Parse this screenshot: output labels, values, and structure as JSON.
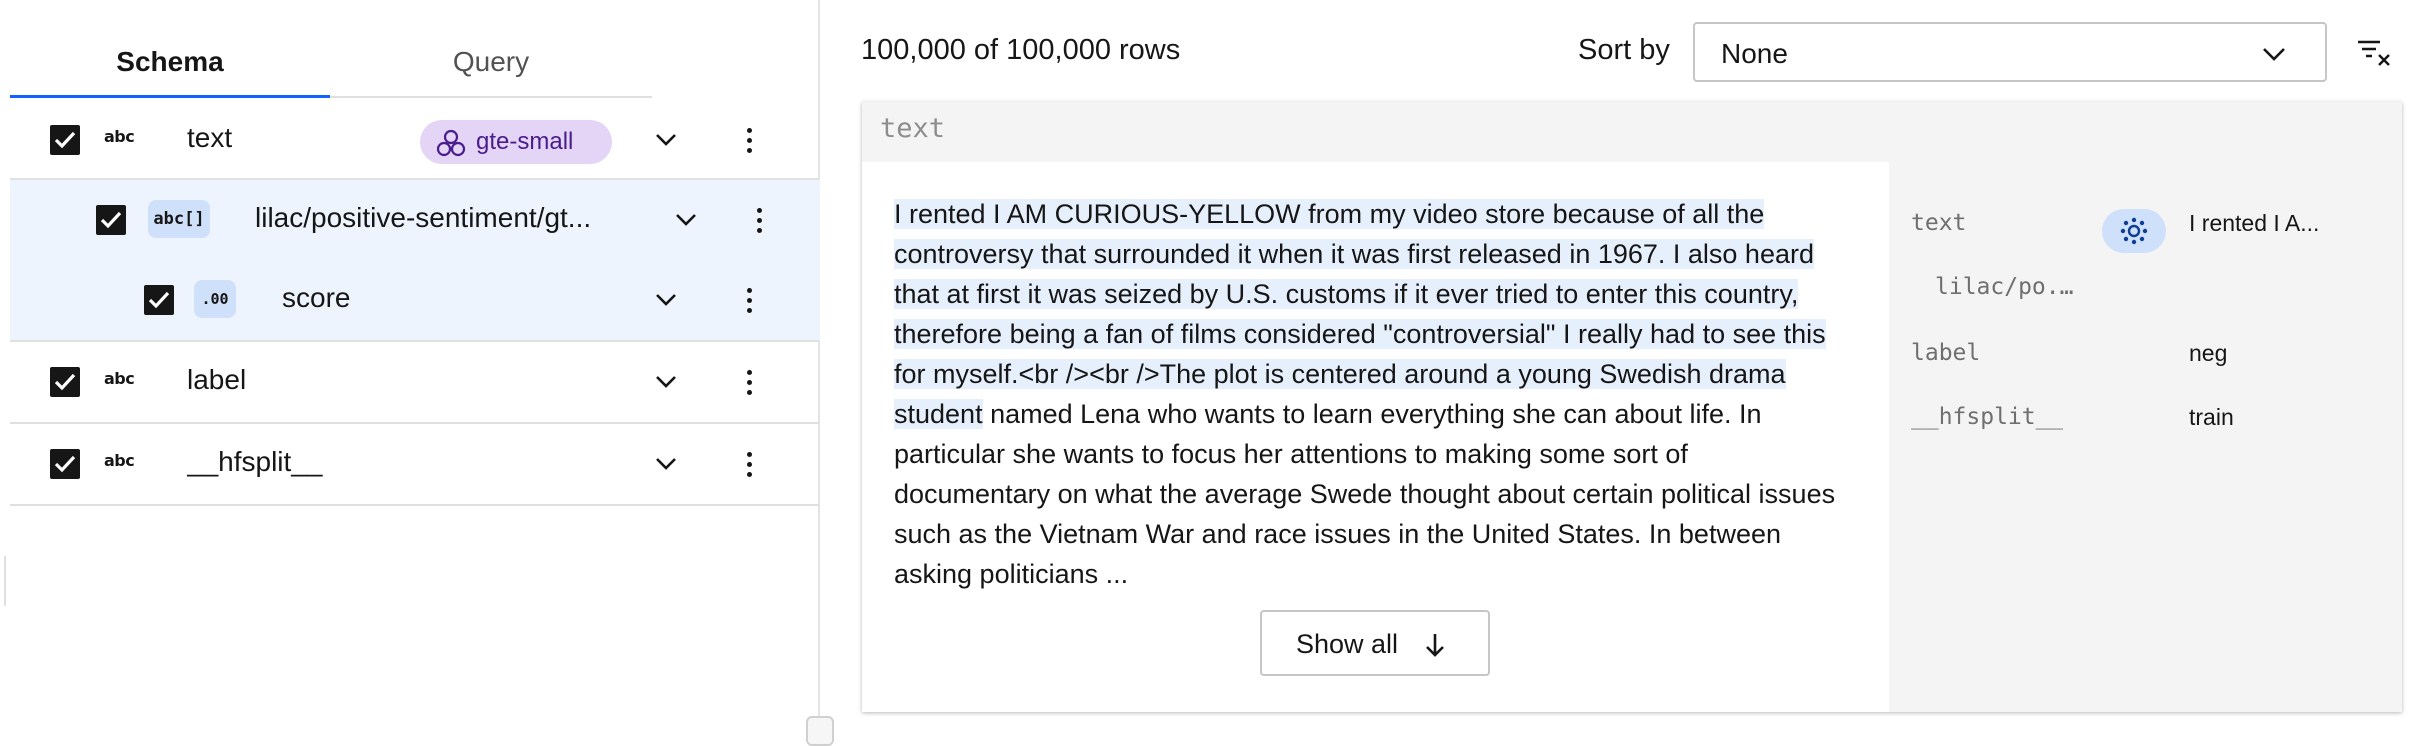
{
  "schema_panel": {
    "tabs": [
      {
        "label": "Schema",
        "active": true
      },
      {
        "label": "Query",
        "active": false
      }
    ],
    "fields": [
      {
        "type_icon": "abc",
        "name": "text",
        "checked": true,
        "embedding_badge": "gte-small"
      },
      {
        "type_icon": "abc[]",
        "name": "lilac/positive-sentiment/gt...",
        "checked": true
      },
      {
        "type_icon": ".00",
        "name": "score",
        "checked": true
      },
      {
        "type_icon": "abc",
        "name": "label",
        "checked": true
      },
      {
        "type_icon": "abc",
        "name": "__hfsplit__",
        "checked": true
      }
    ]
  },
  "rows_panel": {
    "row_count": "100,000 of 100,000 rows",
    "sort_label": "Sort by",
    "sort_value": "None",
    "card": {
      "header": "text",
      "text_highlighted": "I rented I AM CURIOUS-YELLOW from my video store because of all the controversy that surrounded it when it was first released in 1967. I also heard that at first it was seized by U.S. customs if it ever tried to enter this country, therefore being a fan of films considered \"controversial\" I really had to see this for myself.<br /><br />The plot is centered around a young Swedish drama student",
      "text_rest": " named Lena who wants to learn everything she can about life. In particular she wants to focus her attentions to making some sort of documentary on what the average Swede thought about certain political issues such as the Vietnam War and race issues in the United States. In between asking politicians ...",
      "show_all_label": "Show all",
      "metadata": [
        {
          "key": "text",
          "value": "I rented I A..."
        },
        {
          "key": "lilac/po...",
          "icon": "signal-icon"
        },
        {
          "key": "label",
          "value": "neg"
        },
        {
          "key": "__hfsplit__",
          "value": "train"
        }
      ]
    }
  },
  "colors": {
    "accent_blue": "#0f62fe",
    "highlight": "#e6effc",
    "child_row_bg": "#eef4fd",
    "embedding_badge_bg": "#e4d5f7",
    "embedding_badge_text": "#491d8b",
    "type_badge_bg": "#cfe0fb"
  }
}
